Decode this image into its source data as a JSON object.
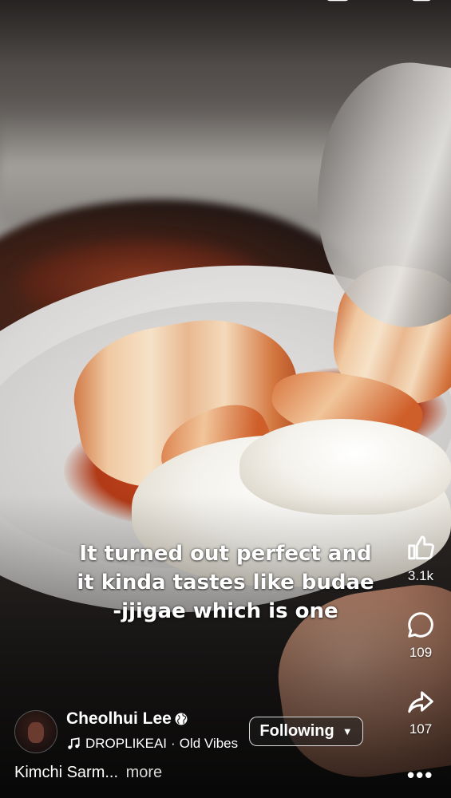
{
  "caption": {
    "lines": [
      "It turned out perfect and",
      "it kinda tastes like budae",
      "-jjigae which is one"
    ]
  },
  "actions": {
    "like": {
      "icon": "thumbs-up-icon",
      "count": "3.1k"
    },
    "comment": {
      "icon": "comment-bubble-icon",
      "count": "109"
    },
    "share": {
      "icon": "share-arrow-icon",
      "count": "107"
    },
    "more": {
      "icon": "more-dots-icon",
      "label": "•••"
    }
  },
  "author": {
    "name": "Cheolhui Lee",
    "privacy_icon": "globe-icon",
    "music_icon": "music-note-icon",
    "music_artist": "DROPLIKEAI",
    "music_separator": "·",
    "music_track": "Old Vibes",
    "follow_label": "Following",
    "follow_caret": "▼"
  },
  "description": {
    "text": "Kimchi Sarm...",
    "more_label": "more"
  },
  "colors": {
    "text": "#ffffff",
    "button_border": "#ffffff"
  }
}
